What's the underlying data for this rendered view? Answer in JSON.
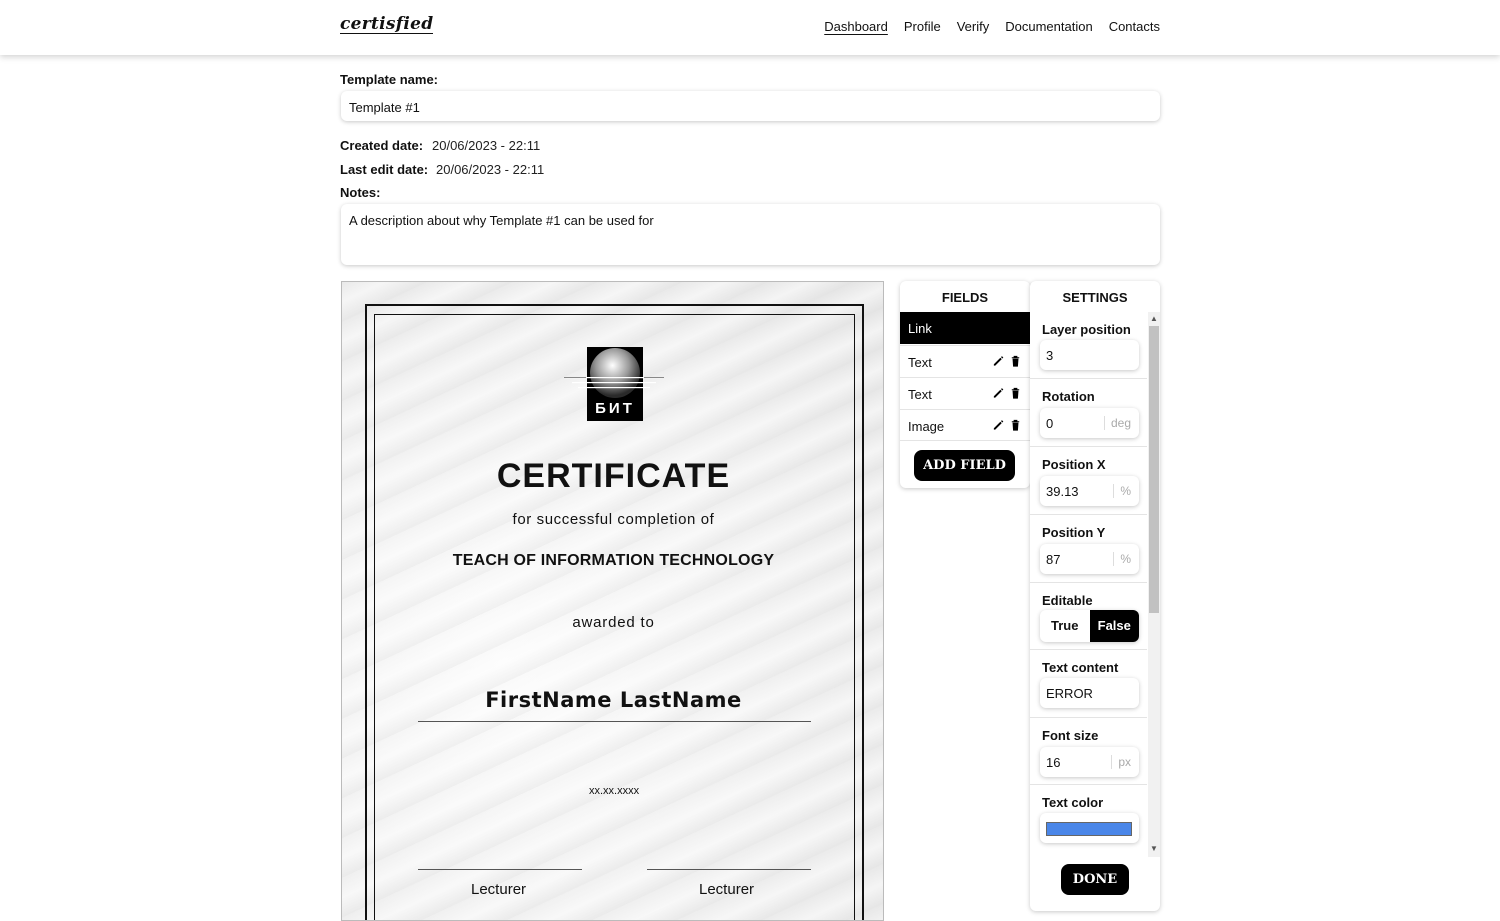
{
  "nav": {
    "logo": "certisfied",
    "links": [
      "Dashboard",
      "Profile",
      "Verify",
      "Documentation",
      "Contacts"
    ]
  },
  "form": {
    "template_name_label": "Template name:",
    "template_name_value": "Template #1",
    "created_label": "Created date:",
    "created_value": "20/06/2023 - 22:11",
    "edited_label": "Last edit date:",
    "edited_value": "20/06/2023 - 22:11",
    "notes_label": "Notes:",
    "notes_value": "A description about why Template #1 can be used for"
  },
  "certificate": {
    "logo_text": "БИТ",
    "title": "CERTIFICATE",
    "subtitle": "for successful completion of",
    "course": "TEACH OF INFORMATION TECHNOLOGY",
    "awarded": "awarded to",
    "name": "FirstName LastName",
    "date": "xx.xx.xxxx",
    "lecturer_left": "Lecturer",
    "lecturer_right": "Lecturer"
  },
  "fields_panel": {
    "title": "FIELDS",
    "items": [
      "Link",
      "Text",
      "Text",
      "Image"
    ],
    "selected_index": 0,
    "add_button": "ADD FIELD"
  },
  "settings_panel": {
    "title": "SETTINGS",
    "layer_label": "Layer position",
    "layer_value": "3",
    "rotation_label": "Rotation",
    "rotation_value": "0",
    "rotation_unit": "deg",
    "posx_label": "Position X",
    "posx_value": "39.13",
    "posx_unit": "%",
    "posy_label": "Position Y",
    "posy_value": "87",
    "posy_unit": "%",
    "editable_label": "Editable",
    "editable_true": "True",
    "editable_false": "False",
    "editable_selected": "False",
    "text_content_label": "Text content",
    "text_content_value": "ERROR",
    "font_size_label": "Font size",
    "font_size_value": "16",
    "font_size_unit": "px",
    "text_color_label": "Text color",
    "text_color_value": "#4a86e8",
    "done_button": "DONE"
  }
}
